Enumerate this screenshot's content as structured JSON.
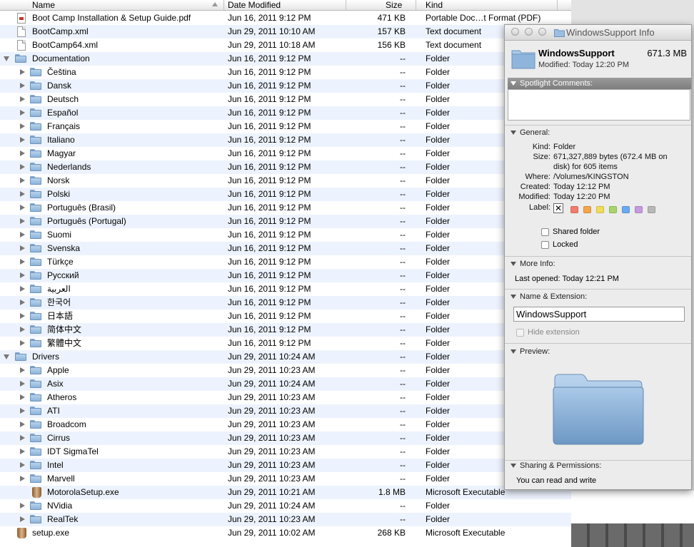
{
  "columns": {
    "name": "Name",
    "date": "Date Modified",
    "size": "Size",
    "kind": "Kind"
  },
  "rows": [
    {
      "name": "Boot Camp Installation & Setup Guide.pdf",
      "date": "Jun 16, 2011 9:12 PM",
      "size": "471 KB",
      "kind": "Portable Doc…t Format (PDF)",
      "icon": "pdf-icon",
      "indent": 0,
      "disclosure": "none"
    },
    {
      "name": "BootCamp.xml",
      "date": "Jun 29, 2011 10:10 AM",
      "size": "157 KB",
      "kind": "Text document",
      "icon": "document-icon",
      "indent": 0,
      "disclosure": "none"
    },
    {
      "name": "BootCamp64.xml",
      "date": "Jun 29, 2011 10:18 AM",
      "size": "156 KB",
      "kind": "Text document",
      "icon": "document-icon",
      "indent": 0,
      "disclosure": "none"
    },
    {
      "name": "Documentation",
      "date": "Jun 16, 2011 9:12 PM",
      "size": "--",
      "kind": "Folder",
      "icon": "folder-icon",
      "indent": 0,
      "disclosure": "open"
    },
    {
      "name": "Čeština",
      "date": "Jun 16, 2011 9:12 PM",
      "size": "--",
      "kind": "Folder",
      "icon": "folder-icon",
      "indent": 1,
      "disclosure": "closed"
    },
    {
      "name": "Dansk",
      "date": "Jun 16, 2011 9:12 PM",
      "size": "--",
      "kind": "Folder",
      "icon": "folder-icon",
      "indent": 1,
      "disclosure": "closed"
    },
    {
      "name": "Deutsch",
      "date": "Jun 16, 2011 9:12 PM",
      "size": "--",
      "kind": "Folder",
      "icon": "folder-icon",
      "indent": 1,
      "disclosure": "closed"
    },
    {
      "name": "Español",
      "date": "Jun 16, 2011 9:12 PM",
      "size": "--",
      "kind": "Folder",
      "icon": "folder-icon",
      "indent": 1,
      "disclosure": "closed"
    },
    {
      "name": "Français",
      "date": "Jun 16, 2011 9:12 PM",
      "size": "--",
      "kind": "Folder",
      "icon": "folder-icon",
      "indent": 1,
      "disclosure": "closed"
    },
    {
      "name": "Italiano",
      "date": "Jun 16, 2011 9:12 PM",
      "size": "--",
      "kind": "Folder",
      "icon": "folder-icon",
      "indent": 1,
      "disclosure": "closed"
    },
    {
      "name": "Magyar",
      "date": "Jun 16, 2011 9:12 PM",
      "size": "--",
      "kind": "Folder",
      "icon": "folder-icon",
      "indent": 1,
      "disclosure": "closed"
    },
    {
      "name": "Nederlands",
      "date": "Jun 16, 2011 9:12 PM",
      "size": "--",
      "kind": "Folder",
      "icon": "folder-icon",
      "indent": 1,
      "disclosure": "closed"
    },
    {
      "name": "Norsk",
      "date": "Jun 16, 2011 9:12 PM",
      "size": "--",
      "kind": "Folder",
      "icon": "folder-icon",
      "indent": 1,
      "disclosure": "closed"
    },
    {
      "name": "Polski",
      "date": "Jun 16, 2011 9:12 PM",
      "size": "--",
      "kind": "Folder",
      "icon": "folder-icon",
      "indent": 1,
      "disclosure": "closed"
    },
    {
      "name": "Português (Brasil)",
      "date": "Jun 16, 2011 9:12 PM",
      "size": "--",
      "kind": "Folder",
      "icon": "folder-icon",
      "indent": 1,
      "disclosure": "closed"
    },
    {
      "name": "Português (Portugal)",
      "date": "Jun 16, 2011 9:12 PM",
      "size": "--",
      "kind": "Folder",
      "icon": "folder-icon",
      "indent": 1,
      "disclosure": "closed"
    },
    {
      "name": "Suomi",
      "date": "Jun 16, 2011 9:12 PM",
      "size": "--",
      "kind": "Folder",
      "icon": "folder-icon",
      "indent": 1,
      "disclosure": "closed"
    },
    {
      "name": "Svenska",
      "date": "Jun 16, 2011 9:12 PM",
      "size": "--",
      "kind": "Folder",
      "icon": "folder-icon",
      "indent": 1,
      "disclosure": "closed"
    },
    {
      "name": "Türkçe",
      "date": "Jun 16, 2011 9:12 PM",
      "size": "--",
      "kind": "Folder",
      "icon": "folder-icon",
      "indent": 1,
      "disclosure": "closed"
    },
    {
      "name": "Русский",
      "date": "Jun 16, 2011 9:12 PM",
      "size": "--",
      "kind": "Folder",
      "icon": "folder-icon",
      "indent": 1,
      "disclosure": "closed"
    },
    {
      "name": "العربية",
      "date": "Jun 16, 2011 9:12 PM",
      "size": "--",
      "kind": "Folder",
      "icon": "folder-icon",
      "indent": 1,
      "disclosure": "closed"
    },
    {
      "name": "한국어",
      "date": "Jun 16, 2011 9:12 PM",
      "size": "--",
      "kind": "Folder",
      "icon": "folder-icon",
      "indent": 1,
      "disclosure": "closed"
    },
    {
      "name": "日本語",
      "date": "Jun 16, 2011 9:12 PM",
      "size": "--",
      "kind": "Folder",
      "icon": "folder-icon",
      "indent": 1,
      "disclosure": "closed"
    },
    {
      "name": "简体中文",
      "date": "Jun 16, 2011 9:12 PM",
      "size": "--",
      "kind": "Folder",
      "icon": "folder-icon",
      "indent": 1,
      "disclosure": "closed"
    },
    {
      "name": "繁體中文",
      "date": "Jun 16, 2011 9:12 PM",
      "size": "--",
      "kind": "Folder",
      "icon": "folder-icon",
      "indent": 1,
      "disclosure": "closed"
    },
    {
      "name": "Drivers",
      "date": "Jun 29, 2011 10:24 AM",
      "size": "--",
      "kind": "Folder",
      "icon": "folder-icon",
      "indent": 0,
      "disclosure": "open"
    },
    {
      "name": "Apple",
      "date": "Jun 29, 2011 10:23 AM",
      "size": "--",
      "kind": "Folder",
      "icon": "folder-icon",
      "indent": 1,
      "disclosure": "closed"
    },
    {
      "name": "Asix",
      "date": "Jun 29, 2011 10:24 AM",
      "size": "--",
      "kind": "Folder",
      "icon": "folder-icon",
      "indent": 1,
      "disclosure": "closed"
    },
    {
      "name": "Atheros",
      "date": "Jun 29, 2011 10:23 AM",
      "size": "--",
      "kind": "Folder",
      "icon": "folder-icon",
      "indent": 1,
      "disclosure": "closed"
    },
    {
      "name": "ATI",
      "date": "Jun 29, 2011 10:23 AM",
      "size": "--",
      "kind": "Folder",
      "icon": "folder-icon",
      "indent": 1,
      "disclosure": "closed"
    },
    {
      "name": "Broadcom",
      "date": "Jun 29, 2011 10:23 AM",
      "size": "--",
      "kind": "Folder",
      "icon": "folder-icon",
      "indent": 1,
      "disclosure": "closed"
    },
    {
      "name": "Cirrus",
      "date": "Jun 29, 2011 10:23 AM",
      "size": "--",
      "kind": "Folder",
      "icon": "folder-icon",
      "indent": 1,
      "disclosure": "closed"
    },
    {
      "name": "IDT SigmaTel",
      "date": "Jun 29, 2011 10:23 AM",
      "size": "--",
      "kind": "Folder",
      "icon": "folder-icon",
      "indent": 1,
      "disclosure": "closed"
    },
    {
      "name": "Intel",
      "date": "Jun 29, 2011 10:23 AM",
      "size": "--",
      "kind": "Folder",
      "icon": "folder-icon",
      "indent": 1,
      "disclosure": "closed"
    },
    {
      "name": "Marvell",
      "date": "Jun 29, 2011 10:23 AM",
      "size": "--",
      "kind": "Folder",
      "icon": "folder-icon",
      "indent": 1,
      "disclosure": "closed"
    },
    {
      "name": "MotorolaSetup.exe",
      "date": "Jun 29, 2011 10:21 AM",
      "size": "1.8 MB",
      "kind": "Microsoft Executable",
      "icon": "executable-icon",
      "indent": 1,
      "disclosure": "none"
    },
    {
      "name": "NVidia",
      "date": "Jun 29, 2011 10:24 AM",
      "size": "--",
      "kind": "Folder",
      "icon": "folder-icon",
      "indent": 1,
      "disclosure": "closed"
    },
    {
      "name": "RealTek",
      "date": "Jun 29, 2011 10:23 AM",
      "size": "--",
      "kind": "Folder",
      "icon": "folder-icon",
      "indent": 1,
      "disclosure": "closed"
    },
    {
      "name": "setup.exe",
      "date": "Jun 29, 2011 10:02 AM",
      "size": "268 KB",
      "kind": "Microsoft Executable",
      "icon": "executable-icon",
      "indent": 0,
      "disclosure": "none"
    }
  ],
  "info": {
    "window_title": "WindowsSupport Info",
    "name": "WindowsSupport",
    "size": "671.3 MB",
    "modified": "Modified: Today 12:20 PM",
    "spotlight": {
      "title": "Spotlight Comments:",
      "value": ""
    },
    "general": {
      "title": "General:",
      "kind_label": "Kind:",
      "kind_value": "Folder",
      "size_label": "Size:",
      "size_value_1": "671,327,889 bytes (672.4 MB on",
      "size_value_2": "disk) for 605 items",
      "where_label": "Where:",
      "where_value": "/Volumes/KINGSTON",
      "created_label": "Created:",
      "created_value": "Today 12:12 PM",
      "modified_label": "Modified:",
      "modified_value": "Today 12:20 PM",
      "label_label": "Label:",
      "label_colors": [
        "#f47b6b",
        "#f4a64a",
        "#f0dd55",
        "#a8d56a",
        "#6aaaf0",
        "#c49ae0",
        "#b8b8b8"
      ],
      "shared_folder": "Shared folder",
      "locked": "Locked"
    },
    "more_info": {
      "title": "More Info:",
      "last_opened": "Last opened: Today 12:21 PM"
    },
    "name_ext": {
      "title": "Name & Extension:",
      "value": "WindowsSupport",
      "hide_extension": "Hide extension"
    },
    "preview": {
      "title": "Preview:"
    },
    "sharing": {
      "title": "Sharing & Permissions:",
      "text": "You can read and write"
    }
  }
}
